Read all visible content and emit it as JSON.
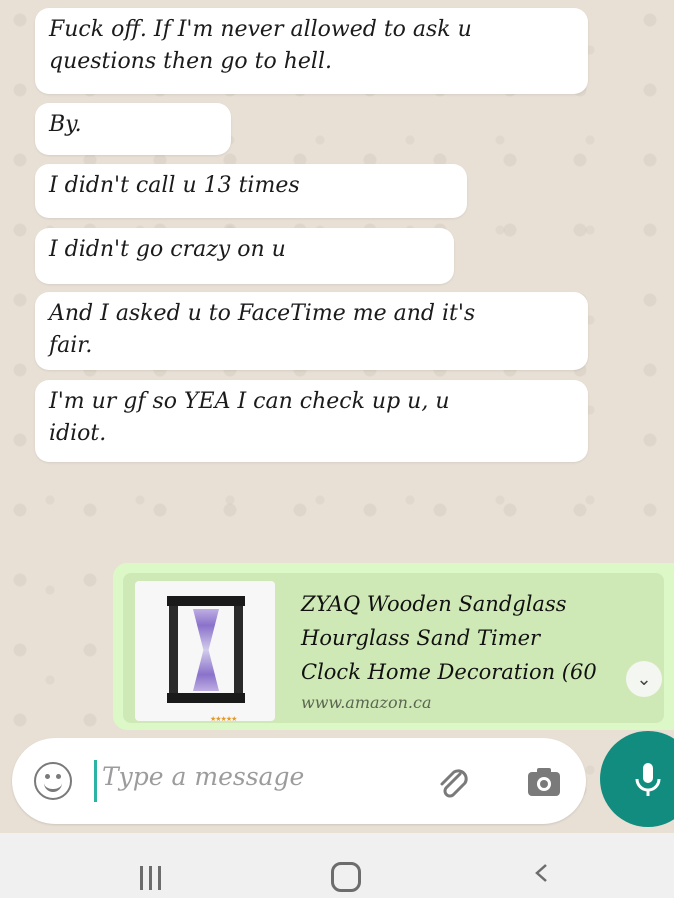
{
  "messages": [
    {
      "text_line1": "Fuck off. If I'm never allowed to ask u",
      "text_line2": "questions then go to hell."
    },
    {
      "text": "By."
    },
    {
      "text": "I didn't call u 13 times"
    },
    {
      "text": "I didn't go crazy on u"
    },
    {
      "text_line1": "And I asked u to FaceTime me and it's",
      "text_line2": "fair."
    },
    {
      "text_line1": "I'm ur gf so YEA I can check up u, u",
      "text_line2": "idiot."
    }
  ],
  "link_preview": {
    "title_line1": "ZYAQ Wooden Sandglass",
    "title_line2": "Hourglass Sand Timer",
    "title_line3": "Clock Home Decoration (60",
    "url": "www.amazon.ca"
  },
  "composer": {
    "placeholder": "Type a message"
  },
  "icons": {
    "emoji": "emoji-icon",
    "attach": "paperclip-icon",
    "camera": "camera-icon",
    "mic": "microphone-icon",
    "expand": "chevron-down-icon",
    "nav_recent": "recent-apps-icon",
    "nav_home": "home-icon",
    "nav_back": "back-icon"
  },
  "colors": {
    "outgoing_bubble": "#dcf8c6",
    "incoming_bubble": "#ffffff",
    "accent": "#128c7e"
  }
}
